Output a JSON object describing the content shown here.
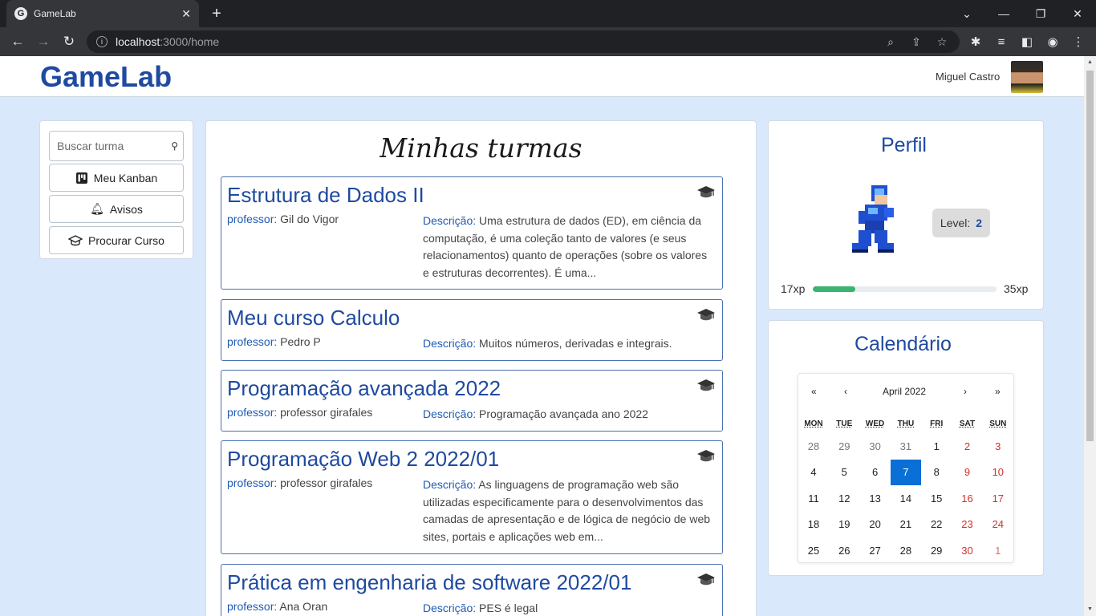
{
  "browser": {
    "tab_title": "GameLab",
    "favicon_letter": "G",
    "url_host": "localhost",
    "url_path": ":3000/home"
  },
  "app": {
    "brand": "GameLab",
    "user_name": "Miguel Castro"
  },
  "sidebar": {
    "search_placeholder": "Buscar turma",
    "buttons": [
      {
        "label": "Meu Kanban",
        "icon": "kanban-icon"
      },
      {
        "label": "Avisos",
        "icon": "bell-icon"
      },
      {
        "label": "Procurar Curso",
        "icon": "graduation-cap-icon"
      }
    ]
  },
  "main": {
    "title": "Minhas turmas",
    "professor_label": "professor:",
    "description_label": "Descrição:",
    "courses": [
      {
        "title": "Estrutura de Dados II",
        "professor": "Gil do Vigor",
        "description": "Uma estrutura de dados (ED), em ciência da computação, é uma coleção tanto de valores (e seus relacionamentos) quanto de operações (sobre os valores e estruturas decorrentes). É uma..."
      },
      {
        "title": "Meu curso Calculo",
        "professor": "Pedro P",
        "description": "Muitos números, derivadas e integrais."
      },
      {
        "title": "Programação avançada 2022",
        "professor": "professor girafales",
        "description": "Programação avançada ano 2022"
      },
      {
        "title": "Programação Web 2 2022/01",
        "professor": "professor girafales",
        "description": "As linguagens de programação web são utilizadas especificamente para o desenvolvimentos das camadas de apresentação e de lógica de negócio de web sites, portais e aplicações web em..."
      },
      {
        "title": "Prática em engenharia de software 2022/01",
        "professor": "Ana Oran",
        "description": "PES é legal"
      }
    ]
  },
  "profile": {
    "title": "Perfil",
    "level_label": "Level:",
    "level_value": "2",
    "xp_current": "17xp",
    "xp_max": "35xp",
    "xp_fraction": 0.23
  },
  "calendar": {
    "title": "Calendário",
    "month_label": "April 2022",
    "nav": {
      "prev_year": "«",
      "prev_month": "‹",
      "next_month": "›",
      "next_year": "»"
    },
    "weekdays": [
      "MON",
      "TUE",
      "WED",
      "THU",
      "FRI",
      "SAT",
      "SUN"
    ],
    "weeks": [
      [
        "28",
        "29",
        "30",
        "31",
        "1",
        "2",
        "3"
      ],
      [
        "4",
        "5",
        "6",
        "7",
        "8",
        "9",
        "10"
      ],
      [
        "11",
        "12",
        "13",
        "14",
        "15",
        "16",
        "17"
      ],
      [
        "18",
        "19",
        "20",
        "21",
        "22",
        "23",
        "24"
      ],
      [
        "25",
        "26",
        "27",
        "28",
        "29",
        "30",
        "1"
      ]
    ],
    "today": "7",
    "accent_color": "#0a6fd6"
  },
  "colors": {
    "brand": "#1f4aa0",
    "page_background": "#d9e9fb",
    "xp_bar": "#3cb371"
  }
}
